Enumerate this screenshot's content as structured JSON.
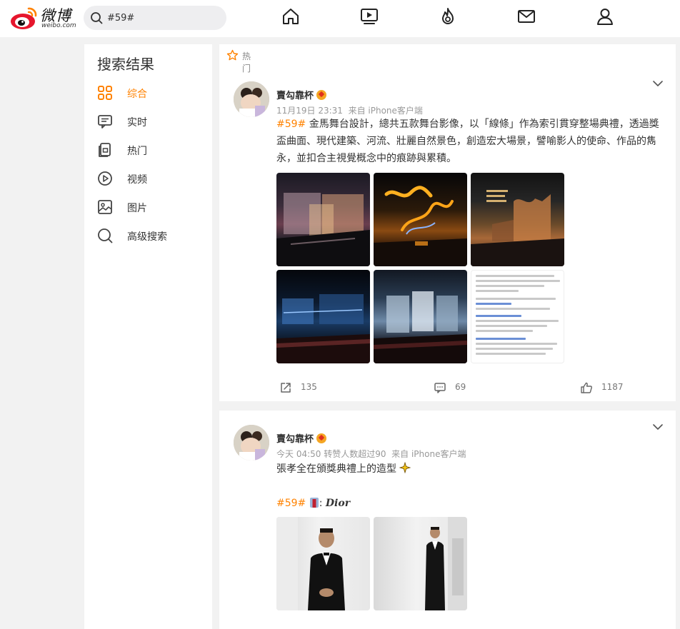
{
  "header": {
    "logo_cn": "微博",
    "logo_en": "weibo.com",
    "search_value": "#59#",
    "nav_icons": [
      "home-icon",
      "video-icon",
      "hot-icon",
      "message-icon",
      "profile-icon"
    ]
  },
  "sidebar": {
    "title": "搜索结果",
    "items": [
      {
        "label": "综合",
        "icon": "grid-icon",
        "active": true
      },
      {
        "label": "实时",
        "icon": "realtime-icon",
        "active": false
      },
      {
        "label": "热门",
        "icon": "hot-feed-icon",
        "active": false
      },
      {
        "label": "视频",
        "icon": "video-play-icon",
        "active": false
      },
      {
        "label": "图片",
        "icon": "image-icon",
        "active": false
      },
      {
        "label": "高级搜索",
        "icon": "advanced-search-icon",
        "active": false
      }
    ]
  },
  "posts": [
    {
      "section_label": "热门",
      "author": "賣勾靠杯",
      "time": "11月19日 23:31",
      "source": "来自 iPhone客户端",
      "tag": "#59#",
      "text": " 金馬舞台設計，總共五款舞台影像，以「線條」作為索引貫穿整場典禮，透過獎盃曲面、現代建築、河流、壯麗自然景色，創造宏大場景，譬喻影人的使命、作品的雋永，並扣合主視覺概念中的痕跡與累積。",
      "images": [
        "stage-a",
        "stage-b",
        "stage-c",
        "stage-d",
        "stage-e",
        "doc"
      ],
      "reposts": "135",
      "comments": "69",
      "likes": "1187"
    },
    {
      "author": "賣勾靠杯",
      "time": "今天 04:50",
      "stat": "转赞人数超过90",
      "source": "来自 iPhone客户端",
      "text": "張孝全在頒獎典禮上的造型",
      "tag": "#59#",
      "brand_text": "Dior",
      "images": [
        "photo",
        "photo"
      ]
    }
  ],
  "colors": {
    "accent": "#ff8200",
    "background": "#f2f2f2"
  }
}
